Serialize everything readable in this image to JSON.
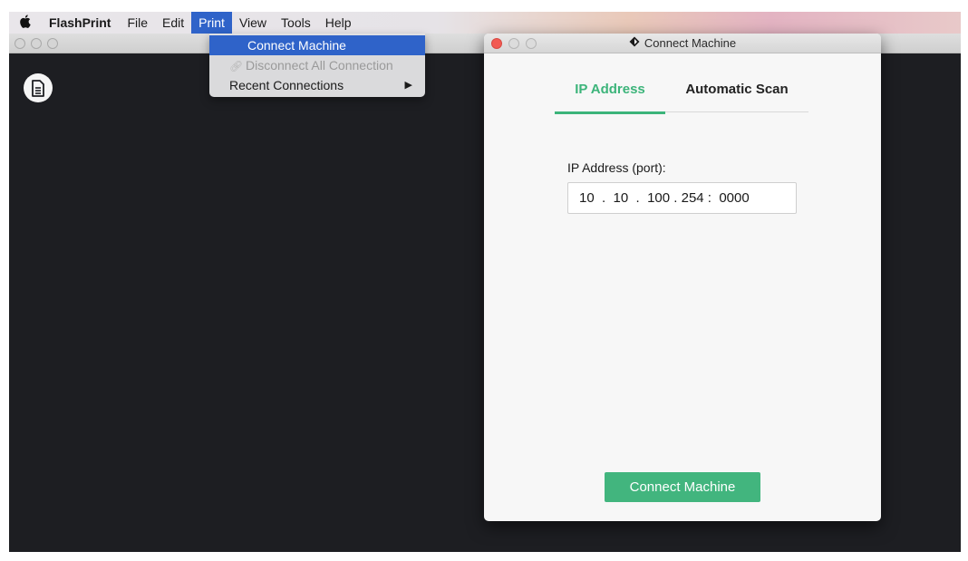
{
  "menubar": {
    "apple_icon": "apple-logo-icon",
    "items": [
      "FlashPrint",
      "File",
      "Edit",
      "Print",
      "View",
      "Tools",
      "Help"
    ],
    "active": "Print"
  },
  "print_menu": {
    "items": [
      {
        "label": "Connect Machine",
        "state": "highlighted"
      },
      {
        "label": "Disconnect All Connection",
        "state": "disabled",
        "icon": "link-icon"
      },
      {
        "label": "Recent Connections",
        "state": "normal",
        "submenu": true
      }
    ]
  },
  "main_window": {
    "icon": "document-icon"
  },
  "dialog": {
    "title": "Connect Machine",
    "title_icon": "diamond-icon",
    "tabs": [
      {
        "label": "IP Address",
        "active": true
      },
      {
        "label": "Automatic Scan",
        "active": false
      }
    ],
    "ip_label": "IP Address (port):",
    "ip_octets": [
      "10",
      "10",
      "100",
      "254"
    ],
    "port": "0000",
    "connect_label": "Connect Machine"
  },
  "colors": {
    "accent_green": "#3cb47a",
    "menu_highlight": "#2f63c9",
    "close_red": "#f25a53",
    "main_bg": "#1d1e22"
  }
}
